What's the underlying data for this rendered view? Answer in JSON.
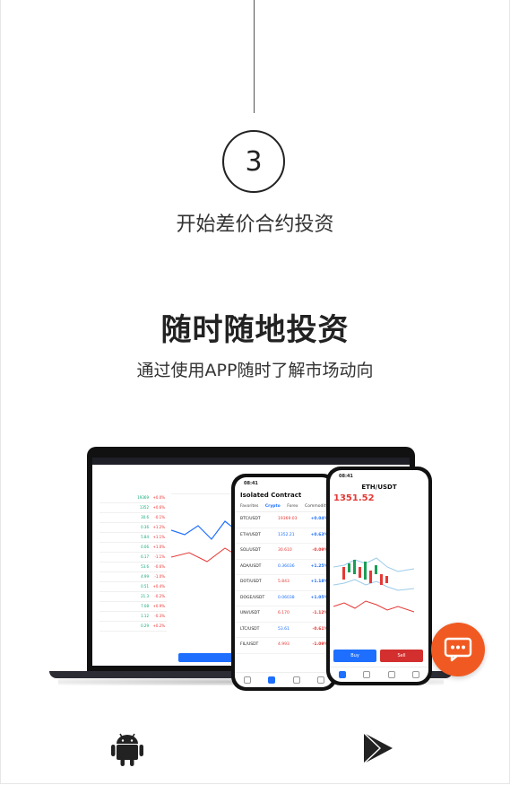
{
  "step": {
    "number": "3",
    "title": "开始差价合约投资"
  },
  "hero": {
    "headline": "随时随地投资",
    "subline": "通过使用APP随时了解市场动向"
  },
  "illustration": {
    "phone_left": {
      "time": "08:41",
      "title": "Isolated Contract",
      "tabs": [
        "Favorites",
        "Crypto",
        "Forex",
        "Commodity"
      ],
      "rows": [
        {
          "symbol": "BTC/USDT",
          "price": "19369.03",
          "change": "+0.04%",
          "dir": "down-up"
        },
        {
          "symbol": "ETH/USDT",
          "price": "1352.21",
          "change": "+0.63%",
          "dir": "up"
        },
        {
          "symbol": "SOL/USDT",
          "price": "30.610",
          "change": "-0.09%",
          "dir": "down"
        },
        {
          "symbol": "ADA/USDT",
          "price": "0.36036",
          "change": "+1.25%",
          "dir": "up"
        },
        {
          "symbol": "DOT/USDT",
          "price": "5.843",
          "change": "+1.18%",
          "dir": "up"
        },
        {
          "symbol": "DOGE/USDT",
          "price": "0.06038",
          "change": "+1.05%",
          "dir": "up"
        },
        {
          "symbol": "UNI/USDT",
          "price": "6.170",
          "change": "-1.12%",
          "dir": "down"
        },
        {
          "symbol": "LTC/USDT",
          "price": "53.61",
          "change": "-0.61%",
          "dir": "down"
        },
        {
          "symbol": "FIL/USDT",
          "price": "4.993",
          "change": "-1.09%",
          "dir": "down"
        }
      ]
    },
    "phone_right": {
      "time": "08:41",
      "pair": "ETH/USDT",
      "price": "1351.52",
      "buy_label": "Buy",
      "sell_label": "Sell"
    },
    "colors": {
      "up": "#1e6fff",
      "down": "#e53935"
    }
  },
  "chat": {
    "icon": "chat-bubble-icon",
    "color": "#f05a22"
  },
  "downloads": {
    "android_icon": "android-icon",
    "play_icon": "google-play-icon"
  }
}
